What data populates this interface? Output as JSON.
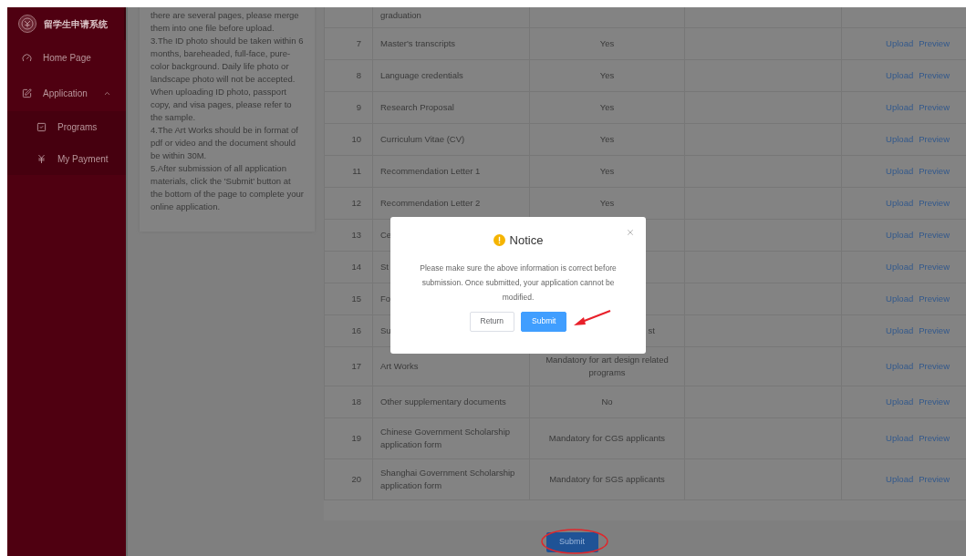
{
  "sidebar": {
    "logo_text": "留学生申请系统",
    "items": [
      {
        "label": "Home Page",
        "kind": "item"
      },
      {
        "label": "Application",
        "kind": "group",
        "expanded": true,
        "children": [
          {
            "label": "Programs",
            "kind": "programs"
          },
          {
            "label": "My Payment",
            "kind": "payment"
          }
        ]
      }
    ]
  },
  "instructions": [
    "there are several pages, please merge them into one file before upload.",
    "3.The ID photo should be taken within 6 months, bareheaded, full-face, pure-color background. Daily life photo or landscape photo will not be accepted. When uploading ID photo, passport copy, and visa pages, please refer to the sample.",
    "4.The Art Works should be in format of pdf or video and the document should be within 30M.",
    "5.After submission of all application materials, click the 'Submit' button at the bottom of the page to complete your online application."
  ],
  "table": {
    "rows": [
      {
        "name": "graduation",
        "actions": []
      },
      {
        "no": "7",
        "name": "Master's transcripts",
        "requirement": "Yes",
        "actions": [
          "Upload",
          "Preview"
        ]
      },
      {
        "no": "8",
        "name": "Language credentials",
        "requirement": "Yes",
        "actions": [
          "Upload",
          "Preview"
        ]
      },
      {
        "no": "9",
        "name": "Research Proposal",
        "requirement": "Yes",
        "actions": [
          "Upload",
          "Preview"
        ]
      },
      {
        "no": "10",
        "name": "Curriculum Vitae (CV)",
        "requirement": "Yes",
        "actions": [
          "Upload",
          "Preview"
        ]
      },
      {
        "no": "11",
        "name": "Recommendation Letter 1",
        "requirement": "Yes",
        "actions": [
          "Upload",
          "Preview"
        ]
      },
      {
        "no": "12",
        "name": "Recommendation Letter 2",
        "requirement": "Yes",
        "actions": [
          "Upload",
          "Preview"
        ]
      },
      {
        "no": "13",
        "name": "Ce",
        "actions": [
          "Upload",
          "Preview"
        ]
      },
      {
        "no": "14",
        "name": "St",
        "actions": [
          "Upload",
          "Preview"
        ]
      },
      {
        "no": "15",
        "name": "Fo",
        "actions": [
          "Upload",
          "Preview"
        ]
      },
      {
        "no": "16",
        "name": "Su",
        "requirement_clipped": "st",
        "actions": [
          "Upload",
          "Preview"
        ]
      },
      {
        "no": "17",
        "name": "Art Works",
        "requirement": "Mandatory for art design related programs",
        "actions": [
          "Upload",
          "Preview"
        ]
      },
      {
        "no": "18",
        "name": "Other supplementary documents",
        "requirement": "No",
        "actions": [
          "Upload",
          "Preview"
        ]
      },
      {
        "no": "19",
        "name": "Chinese Government Scholarship application form",
        "requirement": "Mandatory for CGS applicants",
        "actions": [
          "Upload",
          "Preview"
        ]
      },
      {
        "no": "20",
        "name": "Shanghai Government Scholarship application form",
        "requirement": "Mandatory for SGS applicants",
        "actions": [
          "Upload",
          "Preview"
        ]
      }
    ]
  },
  "submit_button": "Submit",
  "dialog": {
    "title": "Notice",
    "message": "Please make sure the above information is correct before submission. Once submitted, your application cannot be modified.",
    "buttons": [
      {
        "label": "Return",
        "kind": "default"
      },
      {
        "label": "Submit",
        "kind": "primary"
      }
    ]
  }
}
